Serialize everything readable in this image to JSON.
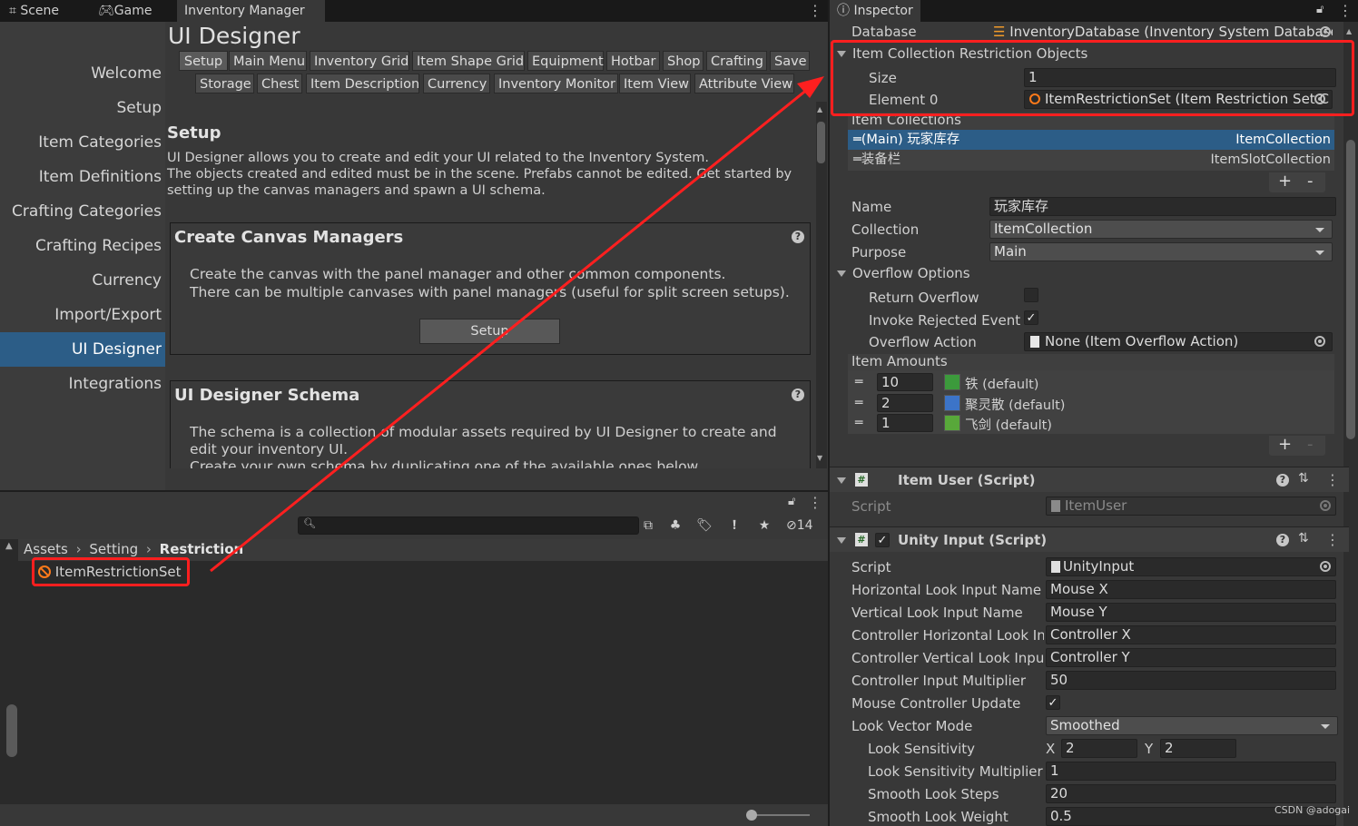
{
  "tabs": {
    "scene": "Scene",
    "game": "Game",
    "inventory_manager": "Inventory Manager"
  },
  "nav": {
    "items": [
      "Welcome",
      "Setup",
      "Item Categories",
      "Item Definitions",
      "Crafting Categories",
      "Crafting Recipes",
      "Currency",
      "Import/Export",
      "UI Designer",
      "Integrations"
    ],
    "selected": "UI Designer"
  },
  "designer": {
    "title": "UI Designer",
    "tabs_row1": [
      "Setup",
      "Main Menu",
      "Inventory Grid",
      "Item Shape Grid",
      "Equipment",
      "Hotbar",
      "Shop",
      "Crafting",
      "Save"
    ],
    "tabs_row2": [
      "Storage",
      "Chest",
      "Item Description",
      "Currency",
      "Inventory Monitor",
      "Item View",
      "Attribute View"
    ],
    "section_title": "Setup",
    "intro_line1": "UI Designer allows you to create and edit your UI related to the Inventory System.",
    "intro_line2": "The objects created and edited must be in the scene. Prefabs cannot be edited. Get started by",
    "intro_line3": "setting up the canvas managers and spawn a UI schema.",
    "canvas_title": "Create Canvas Managers",
    "canvas_line1": "Create the canvas with the panel manager and other common components.",
    "canvas_line2": "There can be multiple canvases with panel managers (useful for split screen setups).",
    "setup_button": "Setup",
    "schema_title": "UI Designer Schema",
    "schema_line1": "The schema is a collection of modular assets required by UI Designer to create and",
    "schema_line2": "edit your inventory UI.",
    "schema_line3": "Create your own schema by duplicating one of the available ones below."
  },
  "project": {
    "search_placeholder": "",
    "hidden_count": "14",
    "breadcrumb": [
      "Assets",
      "Setting",
      "Restriction"
    ],
    "asset": "ItemRestrictionSet"
  },
  "inspector": {
    "tab": "Inspector",
    "database_label": "Database",
    "database_value": "InventoryDatabase (Inventory System Database)",
    "restriction_header": "Item Collection Restriction Objects",
    "size_label": "Size",
    "size_value": "1",
    "element_label": "Element 0",
    "element_value": "ItemRestrictionSet (Item Restriction Set C",
    "collections_header": "Item Collections",
    "collections": [
      {
        "name": "(Main) 玩家库存",
        "type": "ItemCollection"
      },
      {
        "name": "装备栏",
        "type": "ItemSlotCollection"
      }
    ],
    "name_label": "Name",
    "name_value": "玩家库存",
    "collection_label": "Collection",
    "collection_value": "ItemCollection",
    "purpose_label": "Purpose",
    "purpose_value": "Main",
    "overflow_header": "Overflow Options",
    "return_overflow": "Return Overflow",
    "invoke_rejected": "Invoke Rejected Event",
    "overflow_action_label": "Overflow Action",
    "overflow_action_value": "None (Item Overflow Action)",
    "amounts_header": "Item Amounts",
    "amounts": [
      {
        "qty": "10",
        "item": "铁 (default)",
        "color": "#3c9a3c"
      },
      {
        "qty": "2",
        "item": "聚灵散 (default)",
        "color": "#3c74c8"
      },
      {
        "qty": "1",
        "item": "飞剑 (default)",
        "color": "#58a83a"
      }
    ],
    "item_user_header": "Item User (Script)",
    "script_label": "Script",
    "item_user_script": "ItemUser",
    "unity_input_header": "Unity Input (Script)",
    "unity_input_script": "UnityInput",
    "props": [
      {
        "label": "Horizontal Look Input Name",
        "value": "Mouse X"
      },
      {
        "label": "Vertical Look Input Name",
        "value": "Mouse Y"
      },
      {
        "label": "Controller Horizontal Look Inp",
        "value": "Controller X"
      },
      {
        "label": "Controller Vertical Look Input",
        "value": "Controller Y"
      },
      {
        "label": "Controller Input Multiplier",
        "value": "50"
      }
    ],
    "mouse_controller_update": "Mouse Controller Update",
    "look_vector_mode_label": "Look Vector Mode",
    "look_vector_mode_value": "Smoothed",
    "look_sensitivity_label": "Look Sensitivity",
    "x_label": "X",
    "x_value": "2",
    "y_label": "Y",
    "y_value": "2",
    "props2": [
      {
        "label": "Look Sensitivity Multiplier",
        "value": "1"
      },
      {
        "label": "Smooth Look Steps",
        "value": "20"
      },
      {
        "label": "Smooth Look Weight",
        "value": "0.5"
      }
    ]
  },
  "watermark": "CSDN @adogai",
  "colors": {
    "selection": "#2c5d87",
    "highlight": "#ff1f1f",
    "panel": "#383838"
  }
}
